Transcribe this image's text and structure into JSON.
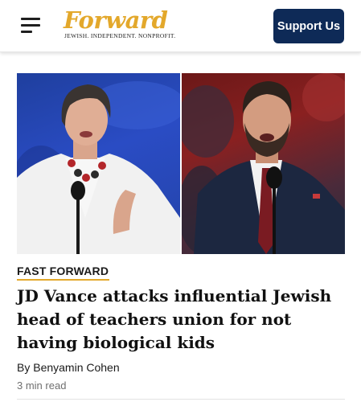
{
  "header": {
    "logo_word": "Forward",
    "logo_tagline": "JEWISH. INDEPENDENT. NONPROFIT.",
    "support_label": "Support Us",
    "icons": {
      "menu": "hamburger-menu-icon"
    }
  },
  "article": {
    "section_label": "FAST FORWARD",
    "headline": "JD Vance attacks influential Jewish head of teachers union for not having biological kids",
    "byline": "By Benyamin Cohen",
    "read_time": "3 min read"
  },
  "colors": {
    "brand_gold": "#e3a82b",
    "button_navy": "#0e2a57"
  }
}
